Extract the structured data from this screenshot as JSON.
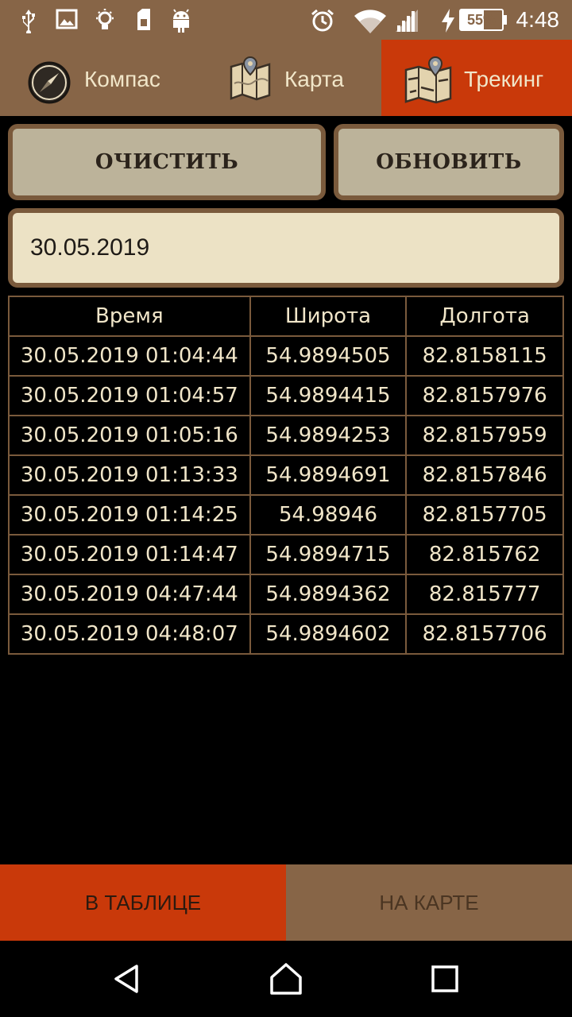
{
  "status_bar": {
    "time": "4:48",
    "battery_percent": "55%",
    "battery_level": 0.55,
    "icons": [
      "usb-icon",
      "image-icon",
      "lightbulb-icon",
      "sim-icon",
      "android-icon",
      "alarm-icon",
      "wifi-icon",
      "signal-icon",
      "charging-icon",
      "battery-icon"
    ]
  },
  "tabs": [
    {
      "label": "Компас",
      "icon": "compass-icon",
      "active": false
    },
    {
      "label": "Карта",
      "icon": "map-icon",
      "active": false
    },
    {
      "label": "Трекинг",
      "icon": "tracking-map-icon",
      "active": true
    }
  ],
  "buttons": {
    "clear": "ОЧИСТИТЬ",
    "refresh": "ОБНОВИТЬ"
  },
  "date_field": {
    "value": "30.05.2019"
  },
  "table": {
    "headers": [
      "Время",
      "Широта",
      "Долгота"
    ],
    "rows": [
      [
        "30.05.2019 01:04:44",
        "54.9894505",
        "82.8158115"
      ],
      [
        "30.05.2019 01:04:57",
        "54.9894415",
        "82.8157976"
      ],
      [
        "30.05.2019 01:05:16",
        "54.9894253",
        "82.8157959"
      ],
      [
        "30.05.2019 01:13:33",
        "54.9894691",
        "82.8157846"
      ],
      [
        "30.05.2019 01:14:25",
        "54.98946",
        "82.8157705"
      ],
      [
        "30.05.2019 01:14:47",
        "54.9894715",
        "82.815762"
      ],
      [
        "30.05.2019 04:47:44",
        "54.9894362",
        "82.815777"
      ],
      [
        "30.05.2019 04:48:07",
        "54.9894602",
        "82.8157706"
      ]
    ]
  },
  "bottom_tabs": {
    "table": "В ТАБЛИЦЕ",
    "map": "НА КАРТЕ",
    "active": "table"
  },
  "colors": {
    "brown": "#876547",
    "accent": "#c9390a",
    "beige": "#ece2c5",
    "text_light": "#f1e6c9"
  }
}
